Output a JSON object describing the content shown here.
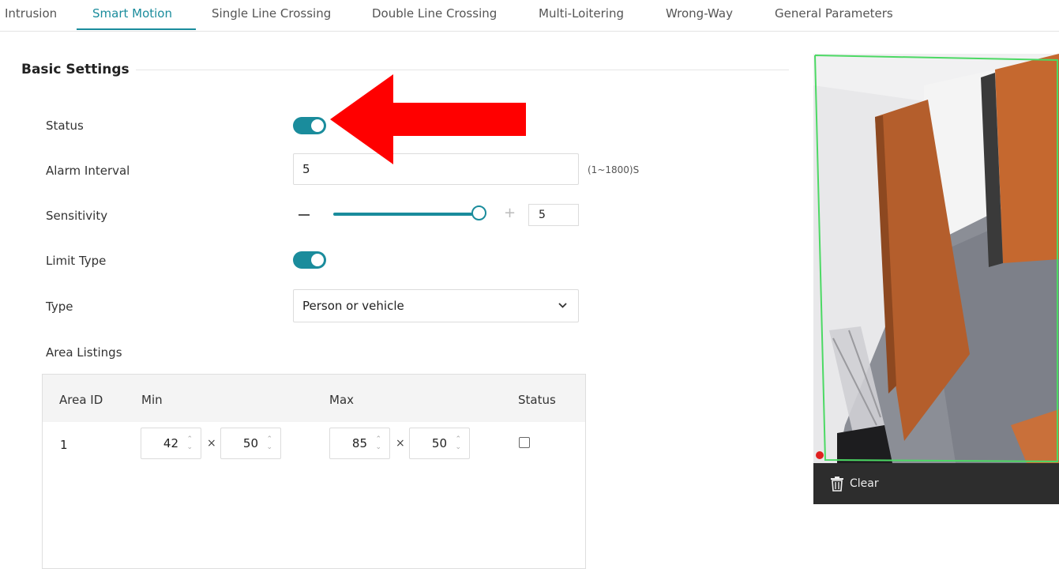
{
  "tabs": [
    {
      "label": "Intrusion",
      "active": false
    },
    {
      "label": "Smart Motion",
      "active": true
    },
    {
      "label": "Single Line Crossing",
      "active": false
    },
    {
      "label": "Double Line Crossing",
      "active": false
    },
    {
      "label": "Multi-Loitering",
      "active": false
    },
    {
      "label": "Wrong-Way",
      "active": false
    },
    {
      "label": "General Parameters",
      "active": false
    }
  ],
  "section_title": "Basic Settings",
  "status": {
    "label": "Status",
    "on": true
  },
  "alarm_interval": {
    "label": "Alarm Interval",
    "value": "5",
    "hint": "(1~1800)S"
  },
  "sensitivity": {
    "label": "Sensitivity",
    "value": "5",
    "level_fraction": 1.0
  },
  "limit_type": {
    "label": "Limit Type",
    "on": true
  },
  "type": {
    "label": "Type",
    "selected": "Person or vehicle"
  },
  "area_listings": {
    "label": "Area Listings",
    "columns": [
      "Area ID",
      "Min",
      "Max",
      "Status"
    ],
    "rows": [
      {
        "area_id": "1",
        "min_w": "42",
        "min_h": "50",
        "max_w": "85",
        "max_h": "50",
        "checked": false
      }
    ],
    "separator": "×"
  },
  "preview": {
    "clear_label": "Clear"
  },
  "colors": {
    "accent": "#1a8c9c",
    "annotation_arrow": "#ff0000",
    "region_outline": "#4cd964"
  },
  "icons": [
    "toggle-icon",
    "chevron-down-icon",
    "spinner-arrows-icon",
    "trash-icon"
  ]
}
